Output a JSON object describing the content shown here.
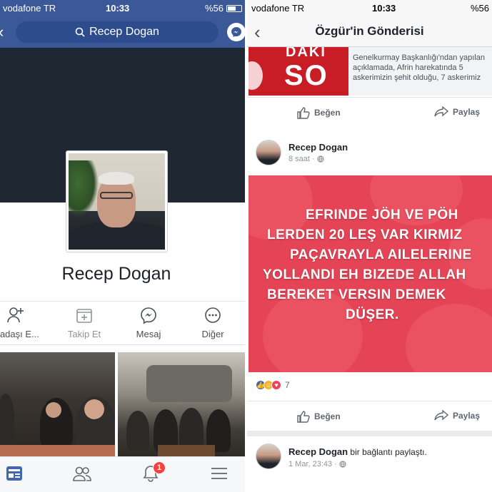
{
  "left": {
    "status": {
      "carrier": "vodafone TR",
      "time": "10:33",
      "battery": "%56"
    },
    "search": {
      "value": "Recep Dogan"
    },
    "profile": {
      "name": "Recep Dogan"
    },
    "actions": [
      {
        "label": "rkadaşı E...",
        "icon": "add-friend-icon"
      },
      {
        "label": "Takip Et",
        "icon": "follow-icon"
      },
      {
        "label": "Mesaj",
        "icon": "messenger-icon"
      },
      {
        "label": "Diğer",
        "icon": "more-icon"
      }
    ],
    "tabbar": {
      "notification_count": "1"
    }
  },
  "right": {
    "status": {
      "carrier": "vodafone TR",
      "time": "10:33",
      "battery": "%56"
    },
    "header": {
      "title": "Özgür'in Gönderisi"
    },
    "shared_news": {
      "image_text_top": "DAKI",
      "image_text_bottom": "SO",
      "lines": [
        "Genelkurmay Başkanlığı'ndan yapılan",
        "açıklamada, Afrin harekatında 5",
        "askerimizin şehit olduğu, 7 askerimiz"
      ]
    },
    "buttons": {
      "like": "Beğen",
      "share": "Paylaş"
    },
    "post": {
      "author": "Recep Dogan",
      "time": "8 saat",
      "image_lines": [
        "EFRINDE JÖH VE PÖH",
        "LERDEN 20 LEŞ VAR  KIRMIZ",
        "PAÇAVRAYLA AILELERINE",
        "YOLLANDI EH BIZEDE ALLAH",
        "BEREKET VERSIN DEMEK",
        "DÜŞER."
      ],
      "reaction_count": "7"
    },
    "next_post": {
      "author": "Recep Dogan",
      "action": "bir bağlantı paylaştı.",
      "time": "1 Mar, 23:43"
    }
  },
  "colors": {
    "facebook_blue": "#3b5998",
    "notification_red": "#fa3e3e",
    "post_red": "#e44455"
  }
}
